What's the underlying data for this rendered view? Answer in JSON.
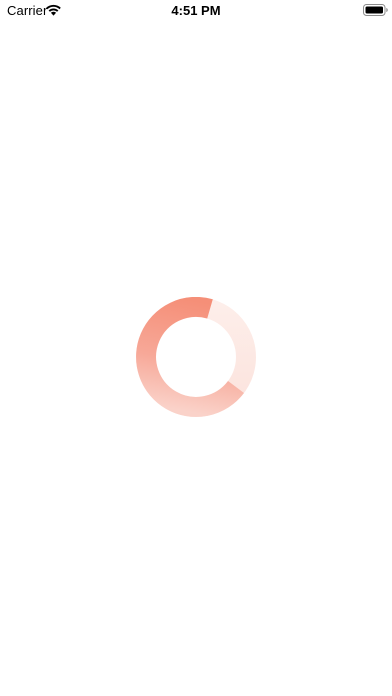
{
  "status_bar": {
    "carrier": "Carrier",
    "time": "4:51 PM",
    "wifi_icon": "wifi-icon",
    "battery_icon": "battery-icon"
  },
  "loader": {
    "icon": "loading-spinner-icon",
    "colors": {
      "accent": "#f58f78",
      "track": "#fde9e5"
    }
  }
}
